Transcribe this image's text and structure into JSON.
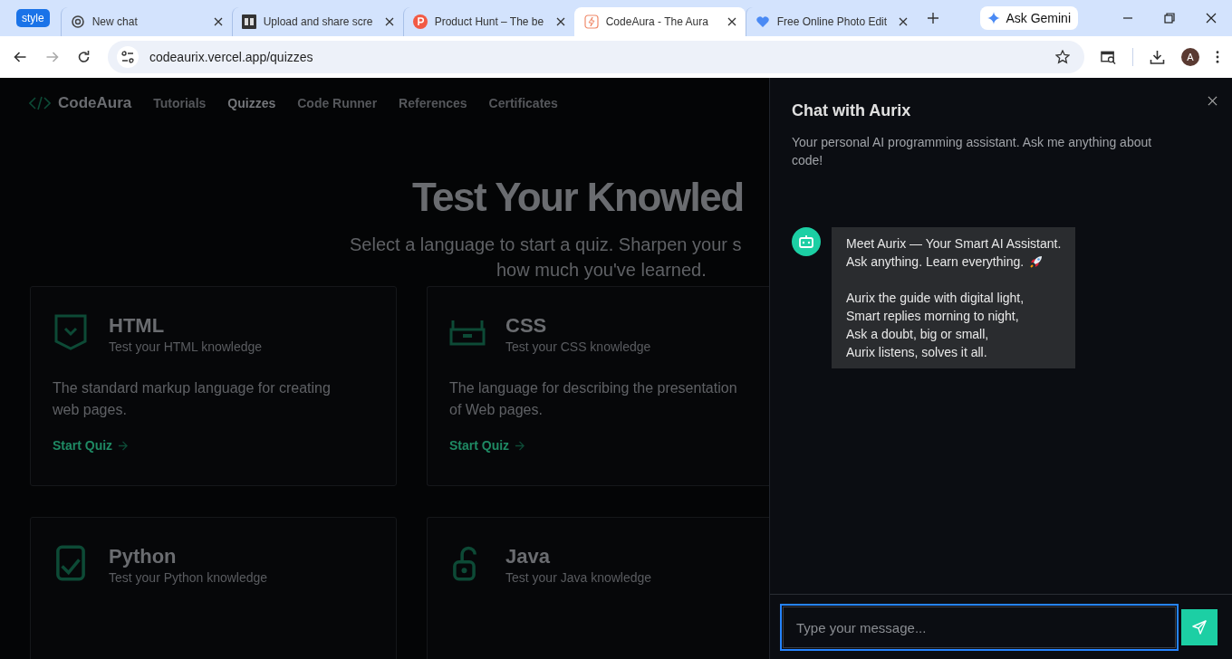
{
  "browser": {
    "tab_group": "style",
    "tabs": [
      {
        "title": "New chat",
        "selected": false
      },
      {
        "title": "Upload and share scre",
        "selected": false
      },
      {
        "title": "Product Hunt – The be",
        "selected": false
      },
      {
        "title": "CodeAura - The Aura",
        "selected": true
      },
      {
        "title": "Free Online Photo Edit",
        "selected": false
      }
    ],
    "ask_gemini": "Ask Gemini",
    "url": "codeaurix.vercel.app/quizzes",
    "avatar": "A"
  },
  "page": {
    "brand": "CodeAura",
    "nav": [
      {
        "label": "Tutorials",
        "selected": false
      },
      {
        "label": "Quizzes",
        "selected": true
      },
      {
        "label": "Code Runner",
        "selected": false
      },
      {
        "label": "References",
        "selected": false
      },
      {
        "label": "Certificates",
        "selected": false
      }
    ],
    "heading": "Test Your Knowled",
    "subtitle_lines": [
      "Select a language to start a quiz. Sharpen your s",
      "how much you've learned."
    ],
    "cards": [
      {
        "title": "HTML",
        "subtitle": "Test your HTML knowledge",
        "description": "The standard markup language for creating web pages.",
        "link": "Start Quiz"
      },
      {
        "title": "CSS",
        "subtitle": "Test your CSS knowledge",
        "description": "The language for describing the presentation of Web pages.",
        "link": "Start Quiz"
      },
      {
        "title": "Python",
        "subtitle": "Test your Python knowledge"
      },
      {
        "title": "Java",
        "subtitle": "Test your Java knowledge"
      }
    ]
  },
  "chat": {
    "title": "Chat with Aurix",
    "subtitle": "Your personal AI programming assistant. Ask me anything about code!",
    "message": {
      "paragraphs": [
        "Meet Aurix — Your Smart AI Assistant.\nAsk anything. Learn everything.",
        "Aurix the guide with digital light,\nSmart replies morning to night,\nAsk a doubt, big or small,\nAurix listens, solves it all."
      ]
    },
    "input": {
      "placeholder": "Type your message..."
    }
  }
}
